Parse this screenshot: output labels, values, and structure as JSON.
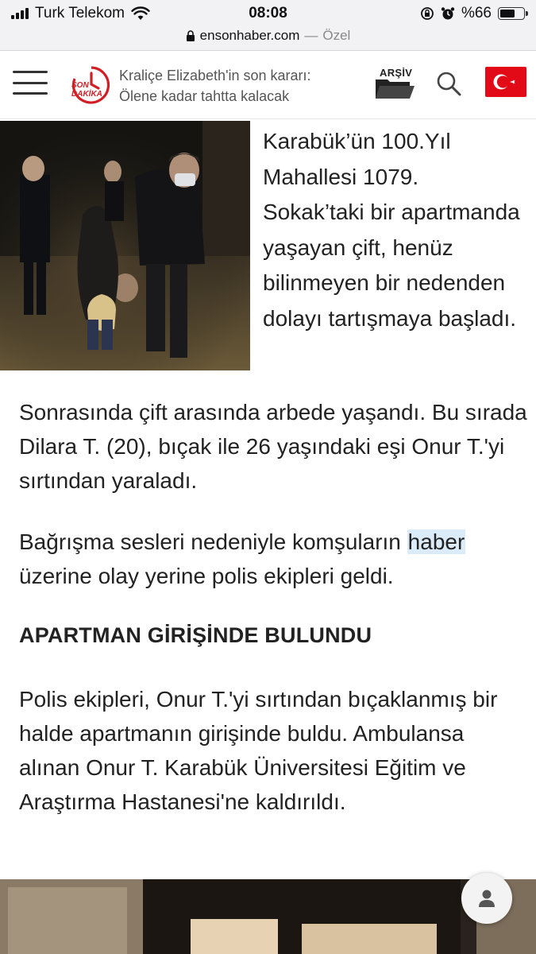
{
  "status_bar": {
    "carrier": "Turk Telekom",
    "time": "08:08",
    "battery_label": "%66",
    "battery_level": 0.66,
    "icons": [
      "signal-icon",
      "wifi-icon",
      "rotation-lock-icon",
      "alarm-icon",
      "battery-icon"
    ]
  },
  "browser": {
    "host": "ensonhaber.com",
    "separator": "—",
    "mode": "Özel"
  },
  "header": {
    "logo_line1": "SON",
    "logo_line2": "DAKİKA",
    "ticker": "Kraliçe Elizabeth'in son kararı: Ölene kadar tahtta kalacak",
    "archive_label": "ARŞİV",
    "colors": {
      "brand_red": "#d21f26",
      "flag_red": "#e30a17"
    }
  },
  "article": {
    "intro": "Karabük’ün 100.Yıl Mahallesi 1079. Sokak’taki bir apartmanda yaşayan çift, henüz bilinmeyen bir nedenden dolayı tartışmaya başladı.",
    "paragraph2": "Sonrasında çift arasında arbede yaşandı. Bu sırada Dilara T. (20), bıçak ile 26 yaşındaki eşi Onur T.'yi sırtından yaraladı.",
    "paragraph3_before": "Bağrışma sesleri nedeniyle komşuların ",
    "paragraph3_link": "haber",
    "paragraph3_after": " üzerine olay yerine polis ekipleri geldi.",
    "subheading": "APARTMAN GİRİŞİNDE BULUNDU",
    "paragraph4": "Polis ekipleri, Onur T.'yi sırtından bıçaklanmış bir halde apartmanın girişinde buldu. Ambulansa alınan Onur T. Karabük Üniversitesi Eğitim ve Araştırma Hastanesi'ne kaldırıldı."
  }
}
